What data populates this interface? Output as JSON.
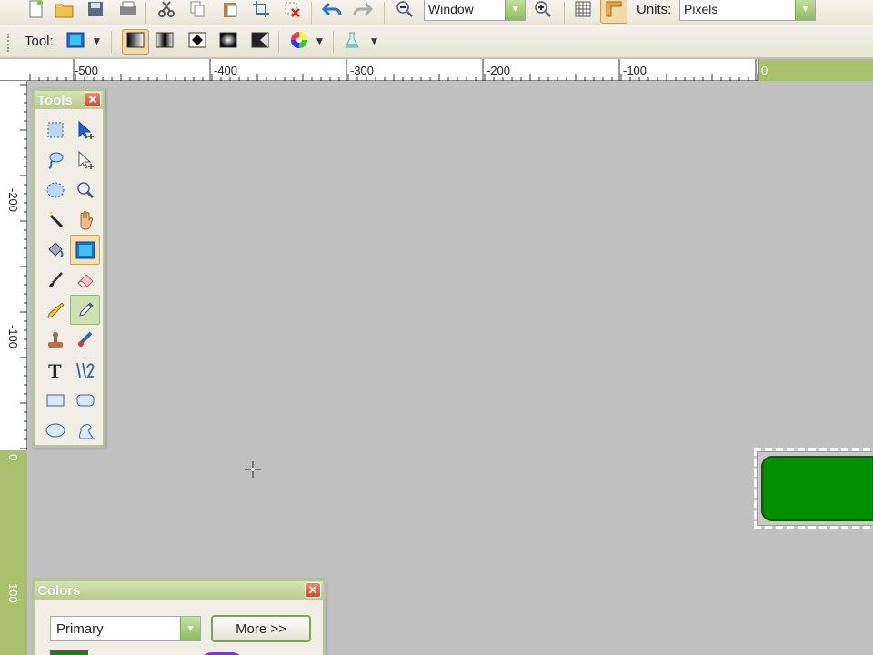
{
  "toolbar": {
    "zoom_value": "Window",
    "units_label": "Units:",
    "units_value": "Pixels",
    "tool_label": "Tool:"
  },
  "rulers": {
    "unit": "px",
    "h_labels": [
      "-500",
      "-400",
      "-300",
      "-200",
      "-100",
      "0"
    ],
    "v_labels": [
      "-200",
      "-100",
      "0",
      "100"
    ]
  },
  "tools_panel": {
    "title": "Tools",
    "tools": [
      "rectangle-select",
      "move-selected-pixels",
      "lasso-select",
      "move-selection",
      "ellipse-select",
      "zoom",
      "magic-wand",
      "pan",
      "paint-bucket",
      "gradient",
      "paintbrush",
      "eraser",
      "pencil",
      "color-picker",
      "clone-stamp",
      "recolor",
      "text",
      "line-curve",
      "rectangle",
      "rounded-rectangle",
      "ellipse",
      "freeform-shape"
    ]
  },
  "colors_panel": {
    "title": "Colors",
    "select_value": "Primary",
    "more_label": "More >>"
  },
  "accent_colors": {
    "panel_border": "#b5c694",
    "shape_fill": "#009000",
    "canvas_bg": "#c0c0c0"
  }
}
